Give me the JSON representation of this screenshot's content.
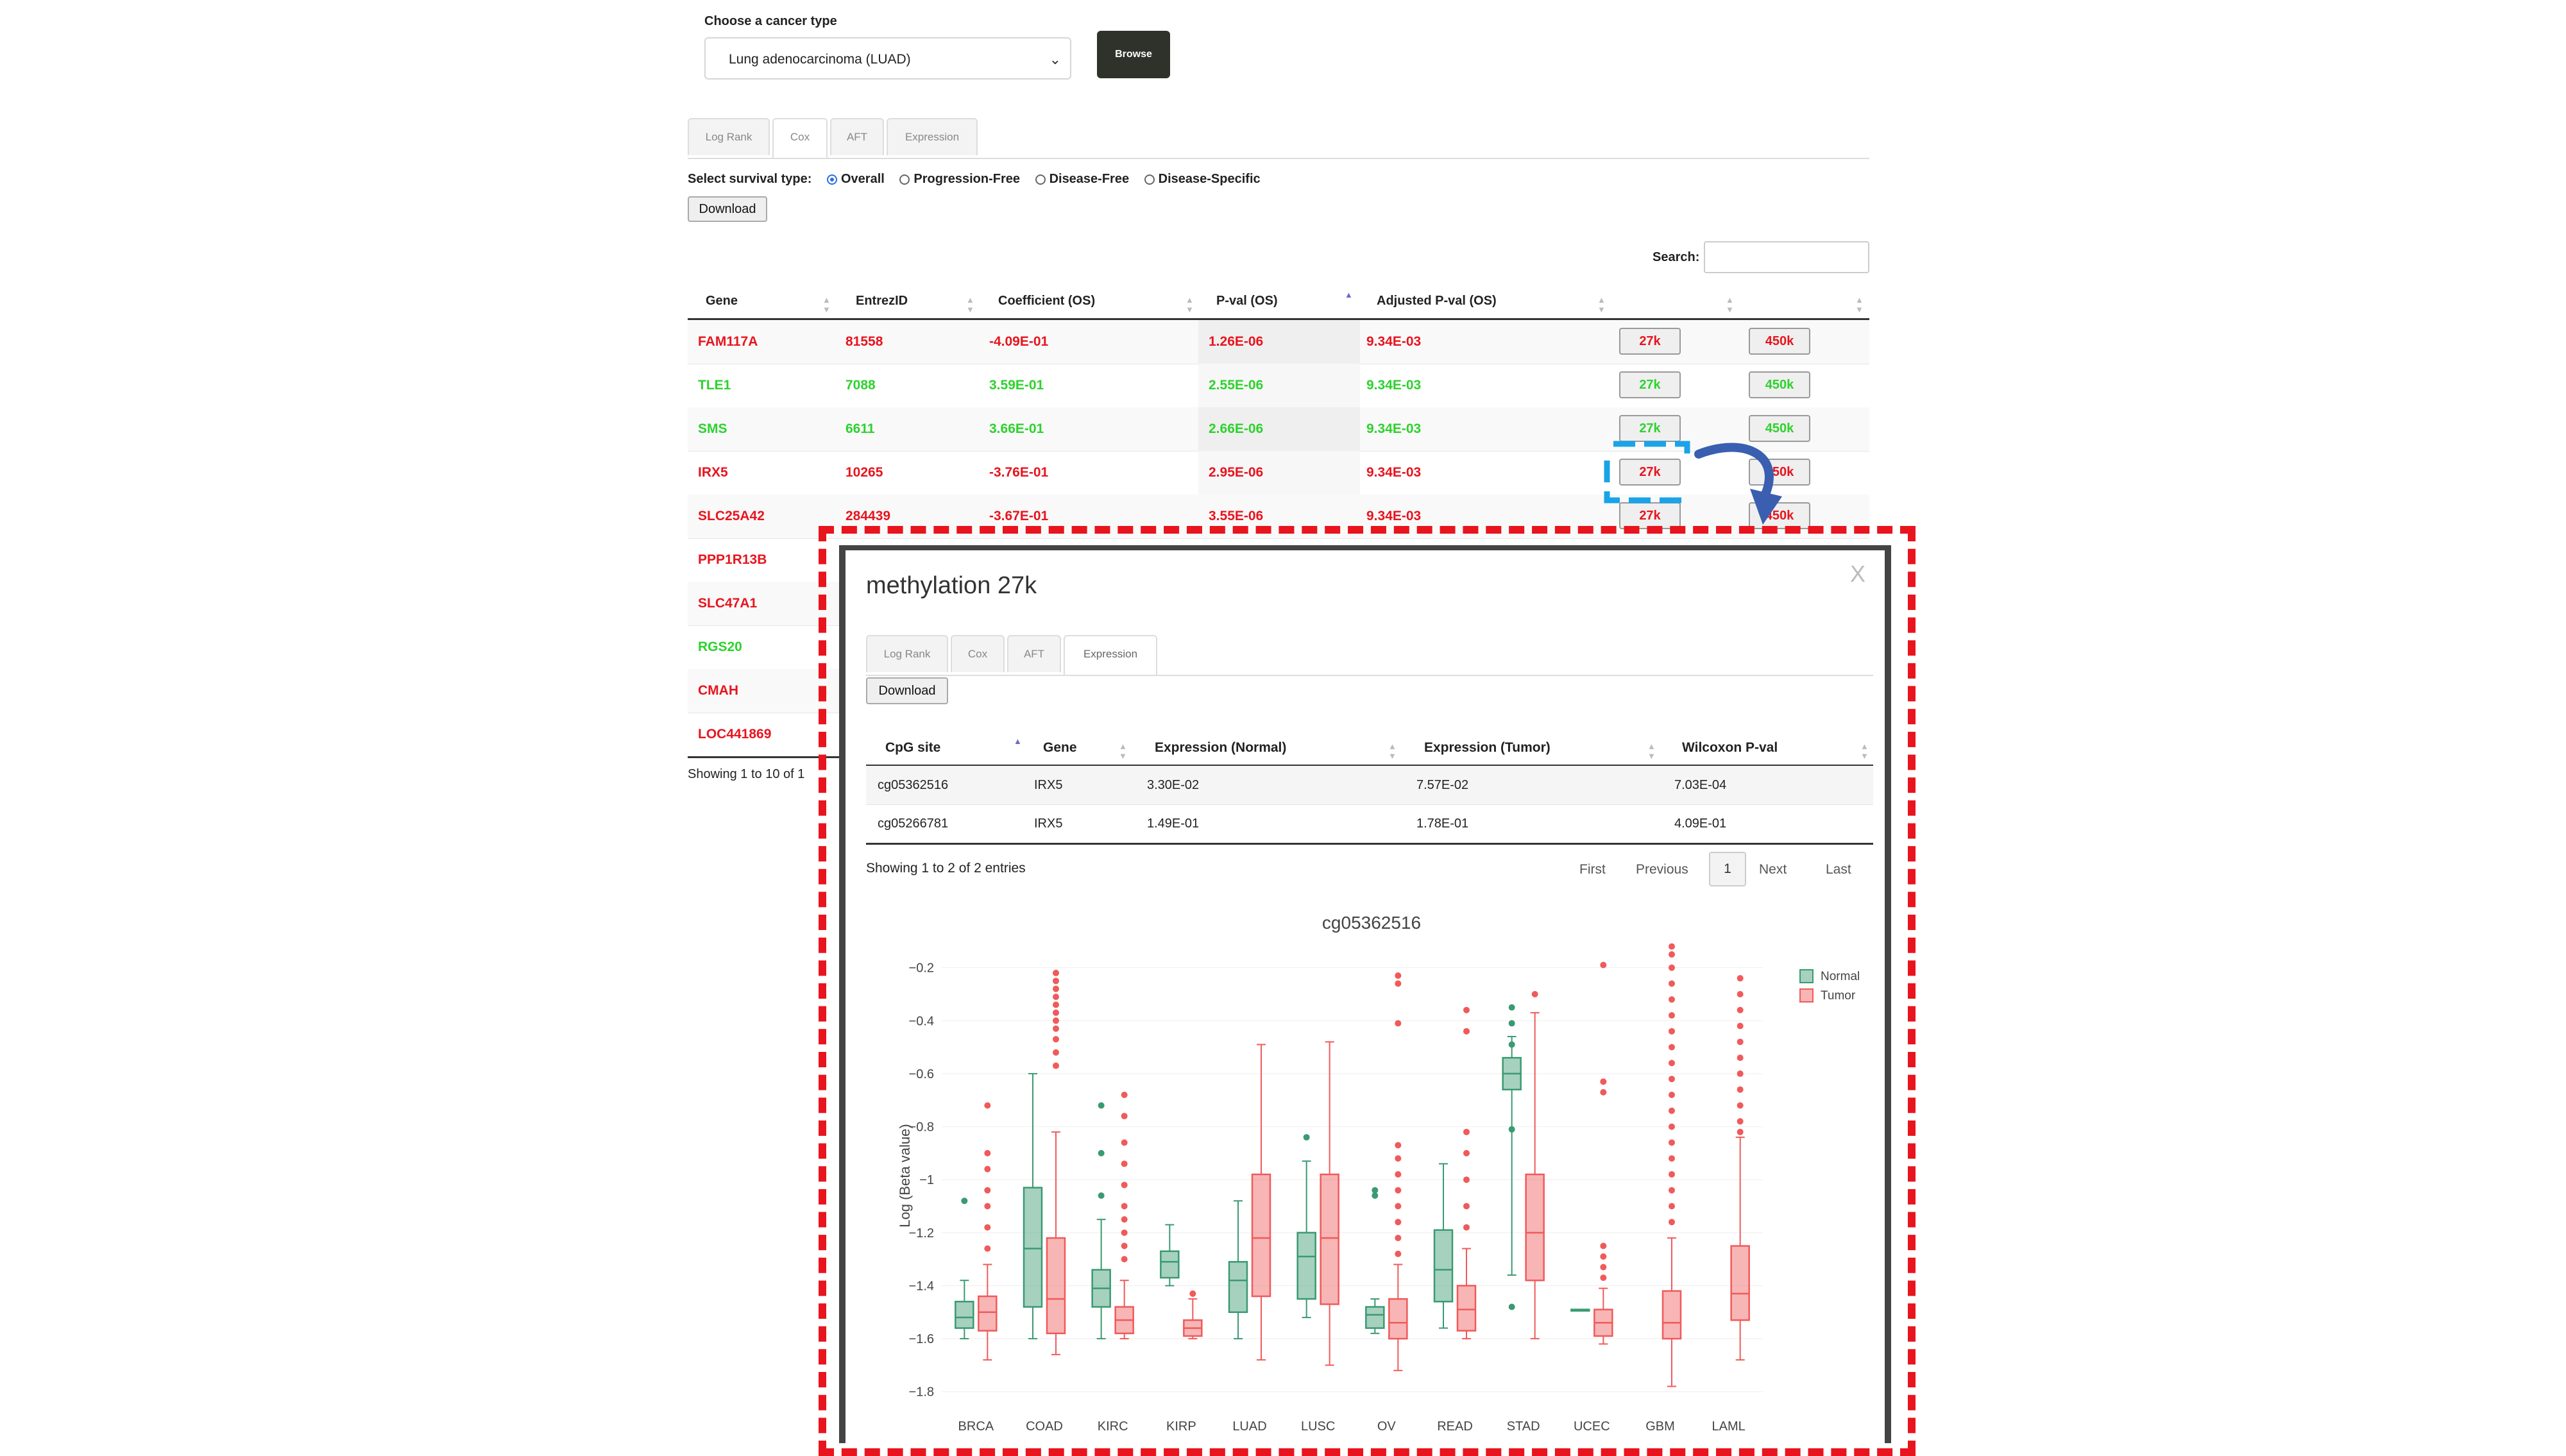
{
  "filter": {
    "cancer_label": "Choose a cancer type",
    "cancer_selected": "Lung adenocarcinoma (LUAD)",
    "browse_label": "Browse"
  },
  "tabs": [
    "Log Rank",
    "Cox",
    "AFT",
    "Expression"
  ],
  "survival": {
    "label": "Select survival type:",
    "options": [
      "Overall",
      "Progression-Free",
      "Disease-Free",
      "Disease-Specific"
    ],
    "selected": "Overall"
  },
  "download_label": "Download",
  "search_label": "Search:",
  "table": {
    "headers": [
      "Gene",
      "EntrezID",
      "Coefficient (OS)",
      "P-val (OS)",
      "Adjusted P-val (OS)"
    ],
    "rows": [
      {
        "gene": "FAM117A",
        "entrez": "81558",
        "coef": "-4.09E-01",
        "pval": "1.26E-06",
        "adj": "9.34E-03",
        "color": "red"
      },
      {
        "gene": "TLE1",
        "entrez": "7088",
        "coef": "3.59E-01",
        "pval": "2.55E-06",
        "adj": "9.34E-03",
        "color": "green"
      },
      {
        "gene": "SMS",
        "entrez": "6611",
        "coef": "3.66E-01",
        "pval": "2.66E-06",
        "adj": "9.34E-03",
        "color": "green"
      },
      {
        "gene": "IRX5",
        "entrez": "10265",
        "coef": "-3.76E-01",
        "pval": "2.95E-06",
        "adj": "9.34E-03",
        "color": "red"
      },
      {
        "gene": "SLC25A42",
        "entrez": "284439",
        "coef": "-3.67E-01",
        "pval": "3.55E-06",
        "adj": "9.34E-03",
        "color": "red"
      },
      {
        "gene": "PPP1R13B",
        "color": "red"
      },
      {
        "gene": "SLC47A1",
        "color": "red"
      },
      {
        "gene": "RGS20",
        "color": "green"
      },
      {
        "gene": "CMAH",
        "color": "red"
      },
      {
        "gene": "LOC441869",
        "color": "red"
      }
    ],
    "btn_27k": "27k",
    "btn_450k": "450k",
    "footer": "Showing 1 to 10 of 1"
  },
  "modal": {
    "title": "methylation 27k",
    "close": "X",
    "tabs": [
      "Log Rank",
      "Cox",
      "AFT",
      "Expression"
    ],
    "download_label": "Download",
    "headers": [
      "CpG site",
      "Gene",
      "Expression (Normal)",
      "Expression (Tumor)",
      "Wilcoxon P-val"
    ],
    "rows": [
      [
        "cg05362516",
        "IRX5",
        "3.30E-02",
        "7.57E-02",
        "7.03E-04"
      ],
      [
        "cg05266781",
        "IRX5",
        "1.49E-01",
        "1.78E-01",
        "4.09E-01"
      ]
    ],
    "footer": "Showing 1 to 2 of 2 entries",
    "pager": [
      "First",
      "Previous",
      "1",
      "Next",
      "Last"
    ]
  },
  "colors": {
    "normal": "#3a9a72",
    "tumor": "#f05a5a",
    "red": "#e8141e",
    "green": "#2dd22d",
    "blue_dash": "#1aa3e8",
    "arrow": "#3a5fb0"
  },
  "chart_data": {
    "type": "box",
    "title": "cg05362516",
    "ylabel": "Log (Beta value)",
    "ylim": [
      -1.82,
      -0.15
    ],
    "yticks": [
      -0.2,
      -0.4,
      -0.6,
      -0.8,
      -1,
      -1.2,
      -1.4,
      -1.6,
      -1.8
    ],
    "ytick_labels": [
      "−0.2",
      "−0.4",
      "−0.6",
      "−0.8",
      "−1",
      "−1.2",
      "−1.4",
      "−1.6",
      "−1.8"
    ],
    "legend_position": "top-right",
    "categories": [
      "BRCA",
      "COAD",
      "KIRC",
      "KIRP",
      "LUAD",
      "LUSC",
      "OV",
      "READ",
      "STAD",
      "UCEC",
      "GBM",
      "LAML"
    ],
    "series": [
      {
        "name": "Normal",
        "boxes": [
          {
            "min": -1.6,
            "q1": -1.56,
            "median": -1.52,
            "q3": -1.46,
            "max": -1.38,
            "outliers": [
              -1.08
            ]
          },
          {
            "min": -1.6,
            "q1": -1.48,
            "median": -1.26,
            "q3": -1.03,
            "max": -0.6,
            "outliers": []
          },
          {
            "min": -1.6,
            "q1": -1.48,
            "median": -1.41,
            "q3": -1.34,
            "max": -1.15,
            "outliers": [
              -1.06,
              -0.9,
              -0.72
            ]
          },
          {
            "min": -1.4,
            "q1": -1.37,
            "median": -1.31,
            "q3": -1.27,
            "max": -1.17,
            "outliers": []
          },
          {
            "min": -1.6,
            "q1": -1.5,
            "median": -1.38,
            "q3": -1.31,
            "max": -1.08,
            "outliers": []
          },
          {
            "min": -1.52,
            "q1": -1.45,
            "median": -1.29,
            "q3": -1.2,
            "max": -0.93,
            "outliers": [
              -0.84
            ]
          },
          {
            "min": -1.58,
            "q1": -1.56,
            "median": -1.51,
            "q3": -1.48,
            "max": -1.45,
            "outliers": [
              -1.06,
              -1.04
            ]
          },
          {
            "min": -1.56,
            "q1": -1.46,
            "median": -1.34,
            "q3": -1.19,
            "max": -0.94,
            "outliers": []
          },
          {
            "min": -1.36,
            "q1": -0.66,
            "median": -0.6,
            "q3": -0.54,
            "max": -0.46,
            "outliers": [
              -0.35,
              -0.41,
              -0.49,
              -0.81,
              -1.48
            ]
          },
          {
            "min": -1.49,
            "q1": -1.49,
            "median": -1.49,
            "q3": -1.49,
            "max": -1.49,
            "outliers": []
          },
          {
            "min": null,
            "q1": null,
            "median": null,
            "q3": null,
            "max": null,
            "outliers": []
          },
          {
            "min": null,
            "q1": null,
            "median": null,
            "q3": null,
            "max": null,
            "outliers": []
          }
        ]
      },
      {
        "name": "Tumor",
        "boxes": [
          {
            "min": -1.68,
            "q1": -1.57,
            "median": -1.5,
            "q3": -1.44,
            "max": -1.32,
            "outliers": [
              -0.72,
              -0.9,
              -0.96,
              -1.04,
              -1.1,
              -1.18,
              -1.26
            ]
          },
          {
            "min": -1.66,
            "q1": -1.58,
            "median": -1.45,
            "q3": -1.22,
            "max": -0.82,
            "outliers": [
              -0.22,
              -0.25,
              -0.28,
              -0.31,
              -0.34,
              -0.37,
              -0.4,
              -0.43,
              -0.47,
              -0.52,
              -0.57
            ]
          },
          {
            "min": -1.6,
            "q1": -1.58,
            "median": -1.53,
            "q3": -1.48,
            "max": -1.38,
            "outliers": [
              -0.68,
              -0.76,
              -0.86,
              -0.94,
              -1.02,
              -1.1,
              -1.15,
              -1.2,
              -1.25,
              -1.3
            ]
          },
          {
            "min": -1.6,
            "q1": -1.59,
            "median": -1.56,
            "q3": -1.53,
            "max": -1.45,
            "outliers": [
              -1.43
            ]
          },
          {
            "min": -1.68,
            "q1": -1.44,
            "median": -1.22,
            "q3": -0.98,
            "max": -0.49,
            "outliers": []
          },
          {
            "min": -1.7,
            "q1": -1.47,
            "median": -1.22,
            "q3": -0.98,
            "max": -0.48,
            "outliers": []
          },
          {
            "min": -1.72,
            "q1": -1.6,
            "median": -1.54,
            "q3": -1.45,
            "max": -1.32,
            "outliers": [
              -0.23,
              -0.26,
              -0.41,
              -0.87,
              -0.92,
              -0.98,
              -1.04,
              -1.1,
              -1.16,
              -1.22,
              -1.28
            ]
          },
          {
            "min": -1.6,
            "q1": -1.57,
            "median": -1.49,
            "q3": -1.4,
            "max": -1.26,
            "outliers": [
              -0.36,
              -0.44,
              -0.82,
              -0.9,
              -1.0,
              -1.1,
              -1.18
            ]
          },
          {
            "min": -1.6,
            "q1": -1.38,
            "median": -1.2,
            "q3": -0.98,
            "max": -0.37,
            "outliers": [
              -0.3
            ]
          },
          {
            "min": -1.62,
            "q1": -1.59,
            "median": -1.54,
            "q3": -1.49,
            "max": -1.41,
            "outliers": [
              -0.19,
              -0.63,
              -0.67,
              -1.25,
              -1.29,
              -1.33,
              -1.37
            ]
          },
          {
            "min": -1.78,
            "q1": -1.6,
            "median": -1.54,
            "q3": -1.42,
            "max": -1.22,
            "outliers": [
              -0.12,
              -0.15,
              -0.2,
              -0.26,
              -0.32,
              -0.38,
              -0.44,
              -0.5,
              -0.56,
              -0.62,
              -0.68,
              -0.74,
              -0.8,
              -0.86,
              -0.92,
              -0.98,
              -1.04,
              -1.1,
              -1.16
            ]
          },
          {
            "min": -1.68,
            "q1": -1.53,
            "median": -1.43,
            "q3": -1.25,
            "max": -0.84,
            "outliers": [
              -0.24,
              -0.3,
              -0.36,
              -0.42,
              -0.48,
              -0.54,
              -0.6,
              -0.66,
              -0.72,
              -0.78,
              -0.82
            ]
          }
        ]
      }
    ]
  }
}
